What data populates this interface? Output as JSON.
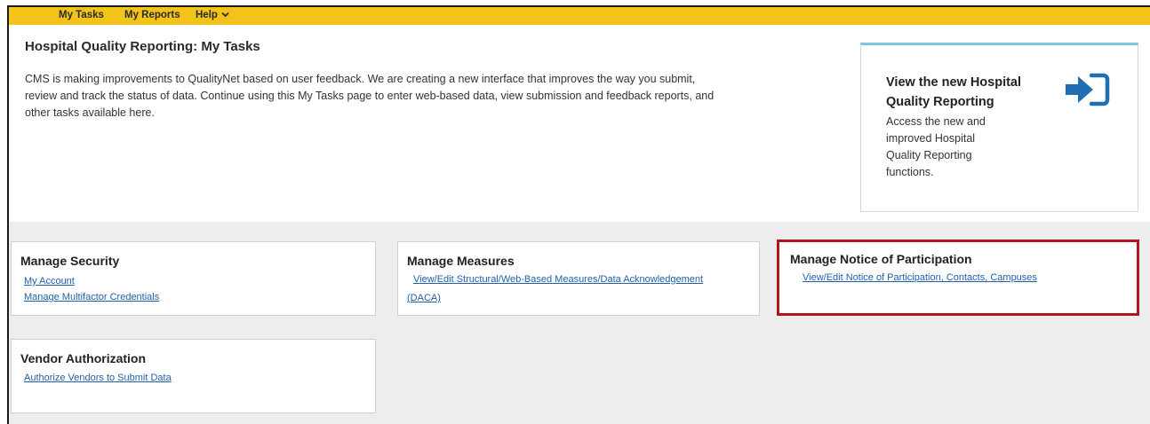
{
  "nav": {
    "my_tasks": "My Tasks",
    "my_reports": "My Reports",
    "help": "Help"
  },
  "page": {
    "title": "Hospital Quality Reporting: My Tasks",
    "intro_line1": "CMS is making improvements to QualityNet based on user feedback. We are creating a new interface that improves the way you submit,",
    "intro_line2": "review and track the status of data. Continue using this My Tasks page to enter web-based data, view submission and feedback reports, and",
    "intro_line3": "other tasks available here."
  },
  "new_card": {
    "title_line1": "View the new Hospital",
    "title_line2": "Quality Reporting",
    "desc_line1": "Access the new and",
    "desc_line2": "improved Hospital",
    "desc_line3": "Quality Reporting",
    "desc_line4": "functions.",
    "icon": "sign-in-arrow-icon"
  },
  "cards": {
    "security": {
      "title": "Manage Security",
      "link1": "My Account",
      "link2": "Manage Multifactor Credentials"
    },
    "measures": {
      "title": "Manage Measures",
      "link1_line1": "View/Edit Structural/Web-Based Measures/Data Acknowledgement",
      "link1_line2": "(DACA)"
    },
    "participation": {
      "title": "Manage Notice of Participation",
      "link1": "View/Edit Notice of Participation, Contacts, Campuses"
    },
    "vendor": {
      "title": "Vendor Authorization",
      "link1": "Authorize Vendors to Submit Data"
    }
  },
  "colors": {
    "nav_bar": "#f2c319",
    "link": "#1f5fa8",
    "highlight": "#b0141c",
    "icon": "#1f6fb2",
    "card_top_border": "#79c7dd"
  }
}
